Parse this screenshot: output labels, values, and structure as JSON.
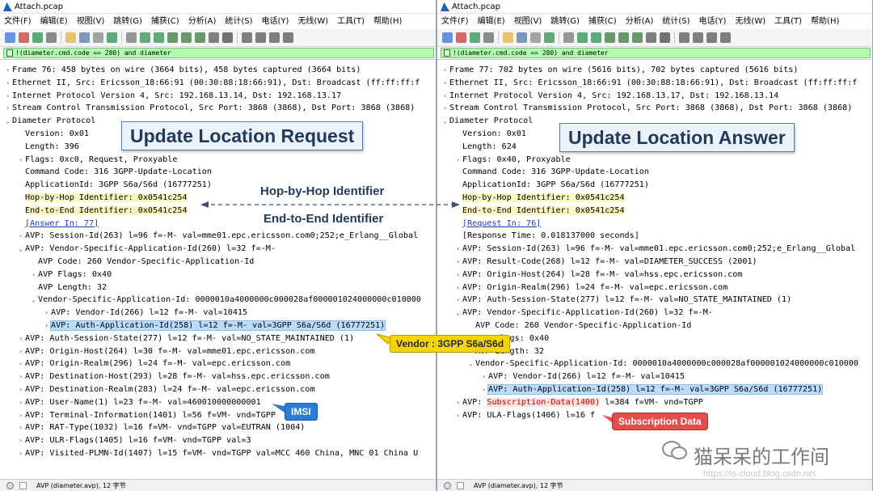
{
  "left": {
    "title": "Attach.pcap",
    "menu": [
      "文件(F)",
      "编辑(E)",
      "视图(V)",
      "跳转(G)",
      "捕获(C)",
      "分析(A)",
      "统计(S)",
      "电话(Y)",
      "无线(W)",
      "工具(T)",
      "帮助(H)"
    ],
    "filter": "!(diameter.cmd.code == 280) and diameter",
    "status": "AVP (diameter.avp), 12 字节",
    "rows": [
      {
        "indent": 0,
        "arrow": "›",
        "text": "Frame 76: 458 bytes on wire (3664 bits), 458 bytes captured (3664 bits)"
      },
      {
        "indent": 0,
        "arrow": "›",
        "text": "Ethernet II, Src: Ericsson_18:66:91 (00:30:88:18:66:91), Dst: Broadcast (ff:ff:ff:f"
      },
      {
        "indent": 0,
        "arrow": "›",
        "text": "Internet Protocol Version 4, Src: 192.168.13.14, Dst: 192.168.13.17"
      },
      {
        "indent": 0,
        "arrow": "›",
        "text": "Stream Control Transmission Protocol, Src Port: 3868 (3868), Dst Port: 3868 (3868)"
      },
      {
        "indent": 0,
        "arrow": "⌄",
        "text": "Diameter Protocol"
      },
      {
        "indent": 1,
        "arrow": "",
        "text": "Version: 0x01"
      },
      {
        "indent": 1,
        "arrow": "",
        "text": "Length: 396"
      },
      {
        "indent": 1,
        "arrow": "›",
        "text": "Flags: 0xc0, Request, Proxyable"
      },
      {
        "indent": 1,
        "arrow": "",
        "text": "Command Code: 316 3GPP-Update-Location"
      },
      {
        "indent": 1,
        "arrow": "",
        "text": "ApplicationId: 3GPP S6a/S6d (16777251)"
      },
      {
        "indent": 1,
        "arrow": "",
        "text": "Hop-by-Hop Identifier: 0x0541c254",
        "style": "yellow"
      },
      {
        "indent": 1,
        "arrow": "",
        "text": "End-to-End Identifier: 0x0541c254",
        "style": "yellow"
      },
      {
        "indent": 1,
        "arrow": "",
        "text": "[Answer In: 77]",
        "style": "link"
      },
      {
        "indent": 1,
        "arrow": "›",
        "text": "AVP: Session-Id(263) l=96 f=-M- val=mme01.epc.ericsson.com0;252;e_Erlang__Global"
      },
      {
        "indent": 1,
        "arrow": "⌄",
        "text": "AVP: Vendor-Specific-Application-Id(260) l=32 f=-M-"
      },
      {
        "indent": 2,
        "arrow": "",
        "text": "AVP Code: 260 Vendor-Specific-Application-Id"
      },
      {
        "indent": 2,
        "arrow": "›",
        "text": "AVP Flags: 0x40"
      },
      {
        "indent": 2,
        "arrow": "",
        "text": "AVP Length: 32"
      },
      {
        "indent": 2,
        "arrow": "⌄",
        "text": "Vendor-Specific-Application-Id: 0000010a4000000c000028af000001024000000c010000"
      },
      {
        "indent": 3,
        "arrow": "›",
        "text": "AVP: Vendor-Id(266) l=12 f=-M- val=10415"
      },
      {
        "indent": 3,
        "arrow": "›",
        "text": "AVP: Auth-Application-Id(258) l=12 f=-M- val=3GPP S6a/S6d (16777251)",
        "style": "blue"
      },
      {
        "indent": 1,
        "arrow": "›",
        "text": "AVP: Auth-Session-State(277) l=12 f=-M- val=NO_STATE_MAINTAINED (1)"
      },
      {
        "indent": 1,
        "arrow": "›",
        "text": "AVP: Origin-Host(264) l=30 f=-M- val=mme01.epc.ericsson.com"
      },
      {
        "indent": 1,
        "arrow": "›",
        "text": "AVP: Origin-Realm(296) l=24 f=-M- val=epc.ericsson.com"
      },
      {
        "indent": 1,
        "arrow": "›",
        "text": "AVP: Destination-Host(293) l=28 f=-M- val=hss.epc.ericsson.com"
      },
      {
        "indent": 1,
        "arrow": "›",
        "text": "AVP: Destination-Realm(283) l=24 f=-M- val=epc.ericsson.com"
      },
      {
        "indent": 1,
        "arrow": "›",
        "text": "AVP: User-Name(1) l=23 f=-M- val=460010000000001"
      },
      {
        "indent": 1,
        "arrow": "›",
        "text": "AVP: Terminal-Information(1401) l=56 f=VM- vnd=TGPP"
      },
      {
        "indent": 1,
        "arrow": "›",
        "text": "AVP: RAT-Type(1032) l=16 f=VM- vnd=TGPP val=EUTRAN (1004)"
      },
      {
        "indent": 1,
        "arrow": "›",
        "text": "AVP: ULR-Flags(1405) l=16 f=VM- vnd=TGPP val=3"
      },
      {
        "indent": 1,
        "arrow": "›",
        "text": "AVP: Visited-PLMN-Id(1407) l=15 f=VM- vnd=TGPP val=MCC 460 China, MNC 01 China U"
      }
    ]
  },
  "right": {
    "title": "Attach.pcap",
    "menu": [
      "文件(F)",
      "编辑(E)",
      "视图(V)",
      "跳转(G)",
      "捕获(C)",
      "分析(A)",
      "统计(S)",
      "电话(Y)",
      "无线(W)",
      "工具(T)",
      "帮助(H)"
    ],
    "filter": "!(diameter.cmd.code == 280) and diameter",
    "status": "AVP (diameter.avp), 12 字节",
    "rows": [
      {
        "indent": 0,
        "arrow": "›",
        "text": "Frame 77: 702 bytes on wire (5616 bits), 702 bytes captured (5616 bits)"
      },
      {
        "indent": 0,
        "arrow": "›",
        "text": "Ethernet II, Src: Ericsson_18:66:91 (00:30:88:18:66:91), Dst: Broadcast (ff:ff:ff:f"
      },
      {
        "indent": 0,
        "arrow": "›",
        "text": "Internet Protocol Version 4, Src: 192.168.13.17, Dst: 192.168.13.14"
      },
      {
        "indent": 0,
        "arrow": "›",
        "text": "Stream Control Transmission Protocol, Src Port: 3868 (3868), Dst Port: 3868 (3868)"
      },
      {
        "indent": 0,
        "arrow": "⌄",
        "text": "Diameter Protocol"
      },
      {
        "indent": 1,
        "arrow": "",
        "text": "Version: 0x01"
      },
      {
        "indent": 1,
        "arrow": "",
        "text": "Length: 624"
      },
      {
        "indent": 1,
        "arrow": "›",
        "text": "Flags: 0x40, Proxyable"
      },
      {
        "indent": 1,
        "arrow": "",
        "text": "Command Code: 316 3GPP-Update-Location"
      },
      {
        "indent": 1,
        "arrow": "",
        "text": "ApplicationId: 3GPP S6a/S6d (16777251)"
      },
      {
        "indent": 1,
        "arrow": "",
        "text": "Hop-by-Hop Identifier: 0x0541c254",
        "style": "yellow"
      },
      {
        "indent": 1,
        "arrow": "",
        "text": "End-to-End Identifier: 0x0541c254",
        "style": "yellow"
      },
      {
        "indent": 1,
        "arrow": "",
        "text": "[Request In: 76]",
        "style": "link"
      },
      {
        "indent": 1,
        "arrow": "",
        "text": "[Response Time: 0.018137000 seconds]"
      },
      {
        "indent": 1,
        "arrow": "›",
        "text": "AVP: Session-Id(263) l=96 f=-M- val=mme01.epc.ericsson.com0;252;e_Erlang__Global"
      },
      {
        "indent": 1,
        "arrow": "›",
        "text": "AVP: Result-Code(268) l=12 f=-M- val=DIAMETER_SUCCESS (2001)"
      },
      {
        "indent": 1,
        "arrow": "›",
        "text": "AVP: Origin-Host(264) l=28 f=-M- val=hss.epc.ericsson.com"
      },
      {
        "indent": 1,
        "arrow": "›",
        "text": "AVP: Origin-Realm(296) l=24 f=-M- val=epc.ericsson.com"
      },
      {
        "indent": 1,
        "arrow": "›",
        "text": "AVP: Auth-Session-State(277) l=12 f=-M- val=NO_STATE_MAINTAINED (1)"
      },
      {
        "indent": 1,
        "arrow": "⌄",
        "text": "AVP: Vendor-Specific-Application-Id(260) l=32 f=-M-"
      },
      {
        "indent": 2,
        "arrow": "",
        "text": "AVP Code: 260 Vendor-Specific-Application-Id"
      },
      {
        "indent": 2,
        "arrow": "›",
        "text": "AVP Flags: 0x40"
      },
      {
        "indent": 2,
        "arrow": "",
        "text": "AVP Length: 32"
      },
      {
        "indent": 2,
        "arrow": "⌄",
        "text": "Vendor-Specific-Application-Id: 0000010a4000000c000028af000001024000000c010000"
      },
      {
        "indent": 3,
        "arrow": "›",
        "text": "AVP: Vendor-Id(266) l=12 f=-M- val=10415"
      },
      {
        "indent": 3,
        "arrow": "›",
        "text": "AVP: Auth-Application-Id(258) l=12 f=-M- val=3GPP S6a/S6d (16777251)",
        "style": "blue"
      },
      {
        "indent": 1,
        "arrow": "›",
        "text": "AVP: Subscription-Data(1400) l=384 f=VM- vnd=TGPP",
        "style": "red"
      },
      {
        "indent": 1,
        "arrow": "›",
        "text": "AVP: ULA-Flags(1406) l=16 f"
      }
    ]
  },
  "overlay": {
    "request_title": "Update Location Request",
    "answer_title": "Update Location Answer",
    "hop_label": "Hop-by-Hop Identifier",
    "e2e_label": "End-to-End Identifier",
    "vendor_badge": "Vendor : 3GPP S6a/S6d",
    "imsi_badge": "IMSI",
    "subscription_badge": "Subscription Data",
    "watermark": "猫呆呆的工作间",
    "watermark_url": "https://is-cloud.blog.csdn.net"
  },
  "colors": {
    "highlight_yellow": "#fbf7c0",
    "selected_blue": "#bcdcff",
    "filter_green": "#afffaf",
    "callout_text": "#1f3a5c"
  }
}
